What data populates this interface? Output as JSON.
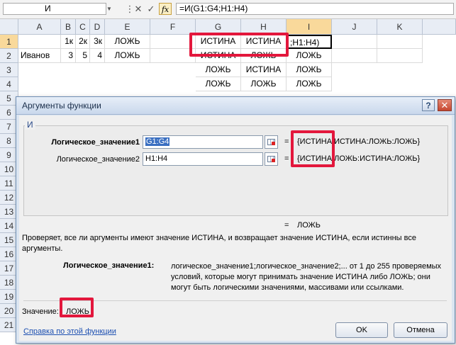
{
  "formula_bar": {
    "name_box": "И",
    "formula": "=И(G1:G4;H1:H4)",
    "fx_label": "fx"
  },
  "columns": [
    "A",
    "B",
    "C",
    "D",
    "E",
    "F",
    "G",
    "H",
    "I",
    "J",
    "K"
  ],
  "rows": [
    "1",
    "2",
    "3",
    "4",
    "5",
    "6",
    "7",
    "8",
    "9",
    "10",
    "11",
    "12",
    "13",
    "14",
    "15",
    "16",
    "17",
    "18",
    "19",
    "20",
    "21"
  ],
  "cells": {
    "B1": "1к",
    "C1": "2к",
    "D1": "3к",
    "E1": "ЛОЖЬ",
    "G1": "ИСТИНА",
    "H1": "ИСТИНА",
    "I1": ";H1:H4)",
    "A2": "Иванов",
    "B2": "3",
    "C2": "5",
    "D2": "4",
    "E2": "ЛОЖЬ",
    "G2": "ИСТИНА",
    "H2": "ЛОЖЬ",
    "I2": "ЛОЖЬ",
    "G3": "ЛОЖЬ",
    "H3": "ИСТИНА",
    "I3": "ЛОЖЬ",
    "G4": "ЛОЖЬ",
    "H4": "ЛОЖЬ",
    "I4": "ЛОЖЬ"
  },
  "dialog": {
    "title": "Аргументы функции",
    "help_glyph": "?",
    "close_glyph": "✕",
    "function_name": "И",
    "arg1_label": "Логическое_значение1",
    "arg1_value": "G1:G4",
    "arg1_result": "{ИСТИНА:ИСТИНА:ЛОЖЬ:ЛОЖЬ}",
    "arg2_label": "Логическое_значение2",
    "arg2_value": "H1:H4",
    "arg2_result": "{ИСТИНА:ЛОЖЬ:ИСТИНА:ЛОЖЬ}",
    "equals": "=",
    "overall_result": "ЛОЖЬ",
    "description": "Проверяет, все ли аргументы имеют значение ИСТИНА, и возвращает значение ИСТИНА, если истинны все аргументы.",
    "arg_help_label": "Логическое_значение1:",
    "arg_help_text": "логическое_значение1;логическое_значение2;... от 1 до 255 проверяемых условий, которые могут принимать значение ИСТИНА либо ЛОЖЬ; они могут быть логическими значениями, массивами или ссылками.",
    "value_label": "Значение:",
    "value_result": "ЛОЖЬ",
    "help_link": "Справка по этой функции",
    "ok_label": "OK",
    "cancel_label": "Отмена"
  },
  "colors": {
    "highlight": "#e3173c",
    "selection": "#3a6fc1"
  }
}
